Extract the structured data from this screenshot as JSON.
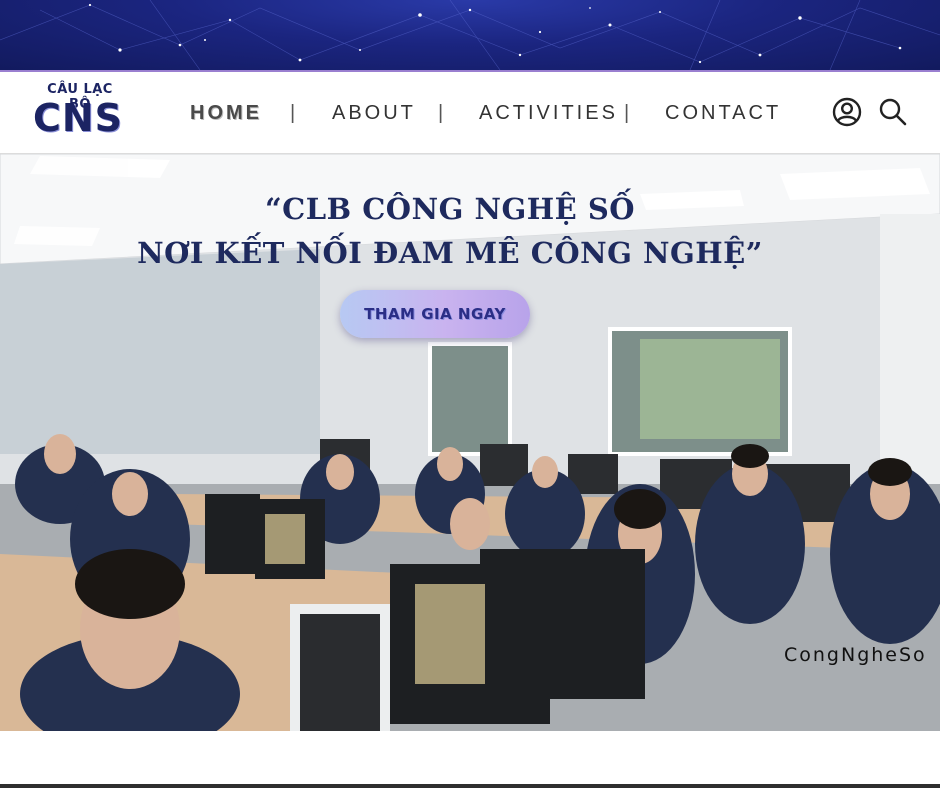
{
  "logo": {
    "top_text": "CÂU LẠC BỘ",
    "main_text": "CNS"
  },
  "nav": {
    "items": [
      {
        "label": "HOME",
        "active": true
      },
      {
        "label": "ABOUT",
        "active": false
      },
      {
        "label": "ACTIVITIES",
        "active": false
      },
      {
        "label": "CONTACT",
        "active": false
      }
    ],
    "separator": "|"
  },
  "icons": {
    "account": "user-circle-icon",
    "search": "search-icon"
  },
  "hero": {
    "title_line1": "“CLB CÔNG NGHỆ SỐ",
    "title_line2": "NƠI KẾT NỐI ĐAM MÊ CÔNG NGHỆ”",
    "cta_label": "THAM GIA NGAY",
    "watermark": "CongNgheSo"
  },
  "colors": {
    "brand_navy": "#1c2463",
    "band": "#1b2580",
    "cta_start": "#b7c9f3",
    "cta_end": "#b8a3ea"
  }
}
